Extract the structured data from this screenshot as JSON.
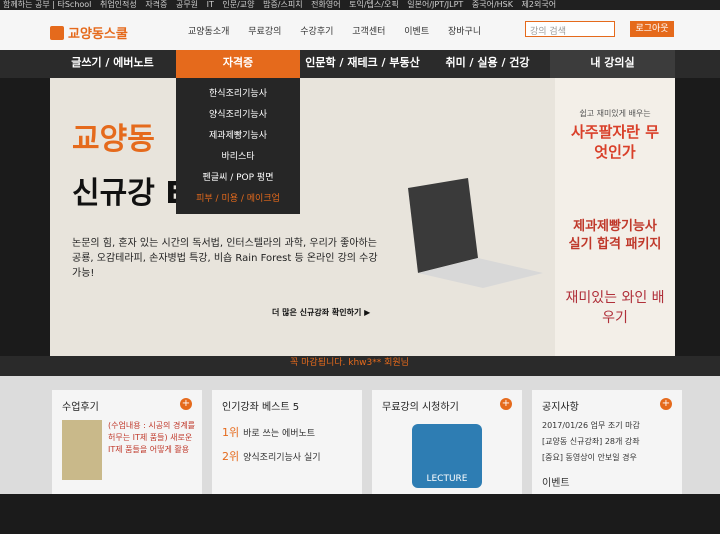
{
  "topbar": [
    "함께하는 공부 | 타School",
    "취업인적성",
    "자격증",
    "공무원",
    "IT",
    "인문/교양",
    "밥증/스피치",
    "전화영어",
    "토익/텝스/오픽",
    "일본어/JPT/JLPT",
    "중국어/HSK",
    "제2외국어"
  ],
  "header": {
    "logo_text": "교양동스쿨",
    "gnb": [
      "교양동소개",
      "무료강의",
      "수강후기",
      "고객센터",
      "이벤트",
      "장바구니"
    ],
    "search_placeholder": "강의 검색",
    "login_label": "로그아웃"
  },
  "nav": {
    "items": [
      "글쓰기 / 에버노트",
      "자격증",
      "인문학 / 재테크 / 부동산",
      "취미 / 실용 / 건강",
      "내 강의실"
    ]
  },
  "dropdown": [
    "한식조리기능사",
    "양식조리기능사",
    "제과제빵기능사",
    "바리스타",
    "펜글씨 / POP 펑면",
    "피부 / 미용 / 메이크업"
  ],
  "hero": {
    "title_line1": "교양동",
    "title_line2": "신규강    EN!",
    "desc": "논문의 힘, 혼자 있는 시간의 독서법, 인터스텔라의 과학, 우리가 좋아하는 공룡, 오감테라피, 손자병법 특강, 비숍 Rain Forest 등 온라인 강의 수강 가능!",
    "more_link": "더 많은 신규강좌 확인하기 ▶"
  },
  "side": {
    "b1_sub": "쉽고 재미있게 배우는",
    "b1_title": "사주팔자란 무엇인가",
    "b2_title": "제과제빵기능사 실기 합격 패키지",
    "b3_title": "재미있는 와인 배우기"
  },
  "notice_strip": {
    "text": "꼭 마감됩니다. khw3** 회원님"
  },
  "bottom": {
    "review": {
      "title": "수업후기",
      "text": "(수업내용 : 시공의 경계를 허무는 IT제 품들) 새로운 IT제 품들을 어떻게 활용"
    },
    "best": {
      "title": "인기강좌 베스트 5",
      "items": [
        {
          "rank": "1위",
          "name": "바로 쓰는 에버노트"
        },
        {
          "rank": "2위",
          "name": "양식조리기능사 실기"
        }
      ]
    },
    "free": {
      "title": "무료강의 시청하기",
      "badge": "LECTURE"
    },
    "notice": {
      "title": "공지사항",
      "items": [
        "2017/01/26 업무 조기 마감",
        "[교양동 신규강좌] 28개 강좌",
        "[중요] 동영상이 안보일 경우"
      ],
      "event": "이벤트"
    }
  },
  "colors": {
    "accent": "#e56a1c"
  }
}
